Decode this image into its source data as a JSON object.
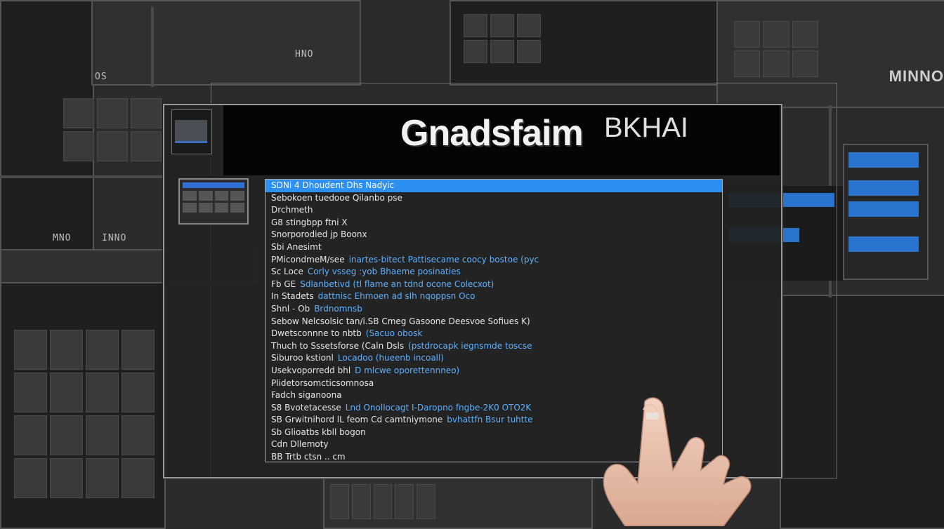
{
  "window": {
    "title": "Gnadsfaim",
    "title_suffix": "BKHAI"
  },
  "background": {
    "corner_label": "MINNO",
    "label_top": "OS",
    "label_mid": "HNO",
    "label_left": "MNO",
    "label_small": "INNO"
  },
  "list": {
    "rows": [
      {
        "c1": "SDNi 4  Dhoudent  Dhs Nadyic",
        "c2": ""
      },
      {
        "c1": "Sebokoen  tuedooe Qilanbo  pse",
        "c2": ""
      },
      {
        "c1": "Drchmeth",
        "c2": ""
      },
      {
        "c1": "G8  stingbpp  ftni X",
        "c2": ""
      },
      {
        "c1": "Snorporodied jp Boonx",
        "c2": ""
      },
      {
        "c1": "Sbi  Anesimt",
        "c2": ""
      },
      {
        "c1": "PMicondmeM/see",
        "c2": "inartes-bitect Pattisecame coocy bostoe (pyc"
      },
      {
        "c1": "Sc  Loce",
        "c2": "Corly vsseg :yob Bhaeme posinaties"
      },
      {
        "c1": "Fb  GE",
        "c2": "Sdlanbetivd (tl  flame an tdnd ocone   Colecxot)"
      },
      {
        "c1": "In  Stadets",
        "c2": "dattnisc  Ehmoen  ad sIh  nqoppsn  Oco"
      },
      {
        "c1": "Shnl - Ob",
        "c2": "Brdnomnsb"
      },
      {
        "c1": "Sebow  Nelcsolsic  tan/i.SB  Cmeg  Gasoone  Deesvoe  Sofiues K)",
        "c2": ""
      },
      {
        "c1": "Dwetsconnne to nbtb",
        "c2": "(Sacuo  obosk"
      },
      {
        "c1": "Thuch to Sssetsforse (Caln  Dsls",
        "c2": "(pstdrocapk iegnsmde  toscse"
      },
      {
        "c1": "Siburoo kstionl",
        "c2": "Locadoo  (hueenb  incoall)"
      },
      {
        "c1": "Usekvoporredd bhl",
        "c2": "D  mlcwe oporettennneo)"
      },
      {
        "c1": "Plidetorsomcticsomnosa",
        "c2": ""
      },
      {
        "c1": "Fadch  siganoona",
        "c2": ""
      },
      {
        "c1": "S8  Bvotetacesse",
        "c2": "Lnd Onollocagt I-Daropno fngbe-2K0 OTO2K"
      },
      {
        "c1": "SB  Grwitnihord  lL  feom Cd camtniymone",
        "c2": "bvhattfn Bsur  tuhtte"
      },
      {
        "c1": "Sb  Glioatbs  kbll  bogon",
        "c2": ""
      },
      {
        "c1": "Cdn  Dllemoty",
        "c2": ""
      },
      {
        "c1": "BB  Trtb  ctsn  ..  cm",
        "c2": ""
      }
    ]
  },
  "colors": {
    "accent": "#2d8ff0",
    "link": "#5fb0ff",
    "panel_bg": "#232323"
  }
}
